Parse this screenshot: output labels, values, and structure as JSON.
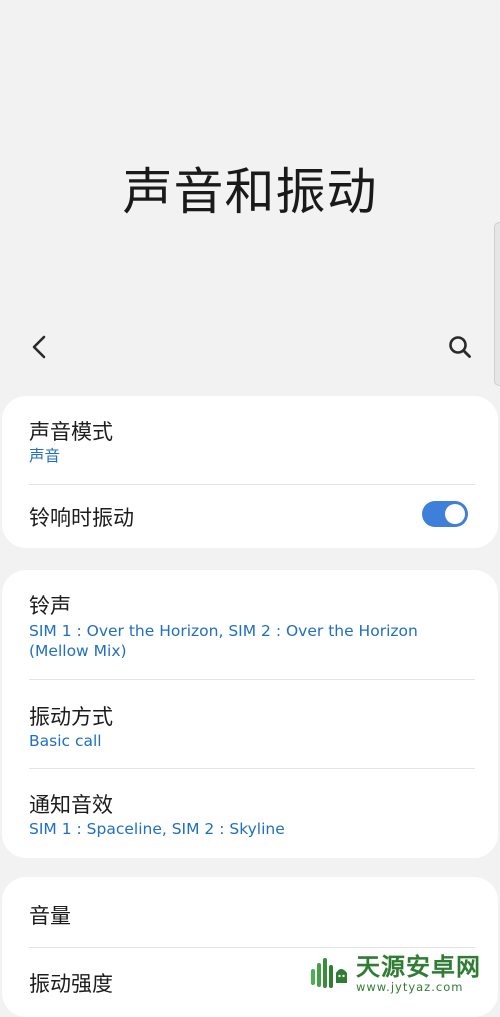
{
  "header": {
    "title": "声音和振动"
  },
  "toolbar": {
    "back_icon": "back-arrow-icon",
    "search_icon": "search-icon"
  },
  "sections": {
    "mode_group": {
      "sound_mode": {
        "title": "声音模式",
        "value": "声音"
      },
      "vibrate_on_ring": {
        "title": "铃响时振动",
        "toggle_on": true
      }
    },
    "ringtone_group": {
      "ringtone": {
        "title": "铃声",
        "value": "SIM 1 : Over the Horizon, SIM 2 : Over the Horizon (Mellow Mix)"
      },
      "vibration_pattern": {
        "title": "振动方式",
        "value": "Basic call"
      },
      "notification_sound": {
        "title": "通知音效",
        "value": "SIM 1 : Spaceline, SIM 2 : Skyline"
      }
    },
    "volume_group": {
      "volume": {
        "title": "音量"
      },
      "vibration_intensity": {
        "title": "振动强度"
      }
    }
  },
  "watermark": {
    "name": "天源安卓网",
    "url": "www.jytyaz.com"
  },
  "colors": {
    "background": "#f2f2f2",
    "card": "#ffffff",
    "accent_text": "#1f6fc4",
    "toggle_on": "#3d7fd9",
    "watermark": "#2f7d33"
  }
}
